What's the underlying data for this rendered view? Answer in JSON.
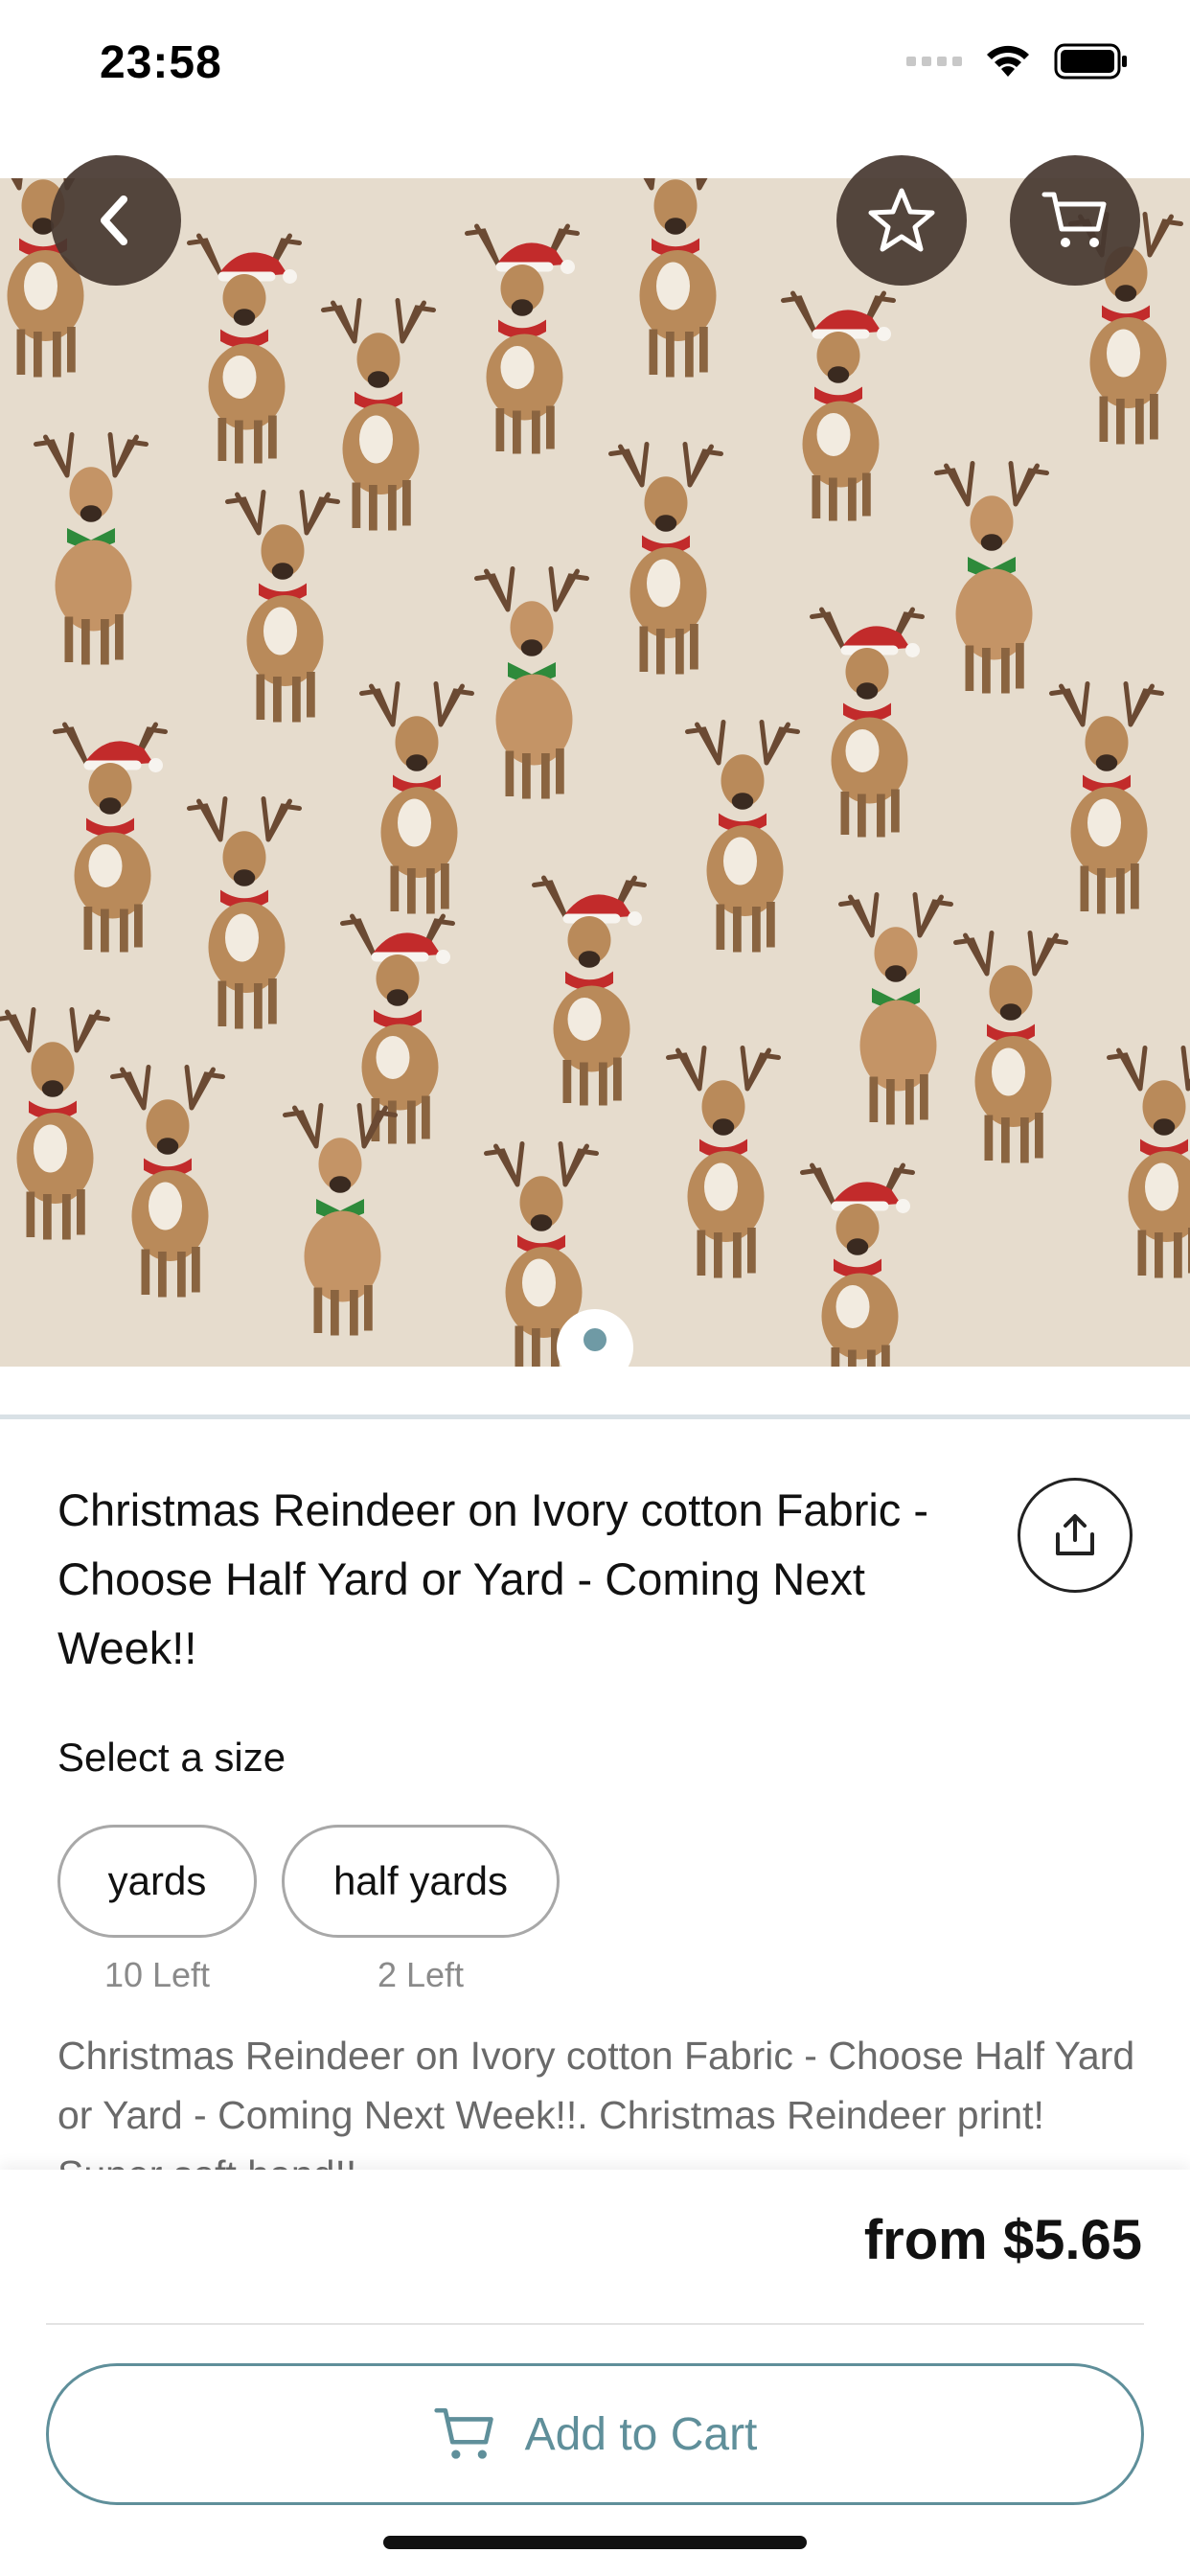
{
  "status_bar": {
    "time": "23:58"
  },
  "hero": {
    "icons": {
      "back": "chevron-left-icon",
      "favorite": "star-icon",
      "cart": "cart-icon"
    },
    "page_indicator": {
      "current": 1,
      "total": 1
    },
    "pattern_colors": {
      "background": "#e6dccd",
      "deer_body": "#b98a5a",
      "scarf_red": "#c22b2b",
      "scarf_green": "#2e8a3b",
      "antler": "#6b4a33"
    }
  },
  "product": {
    "title": "Christmas Reindeer on Ivory cotton Fabric - Choose Half Yard or Yard - Coming Next Week!!",
    "select_size_label": "Select a size",
    "sizes": [
      {
        "label": "yards",
        "stock": "10 Left"
      },
      {
        "label": "half yards",
        "stock": "2 Left"
      }
    ],
    "description": "Christmas Reindeer on Ivory cotton Fabric - Choose Half Yard or Yard - Coming Next Week!!. Christmas Reindeer print! Super soft hand!!"
  },
  "footer": {
    "price": "from $5.65",
    "add_to_cart_label": "Add to Cart",
    "accent_color": "#5f8f9a"
  }
}
